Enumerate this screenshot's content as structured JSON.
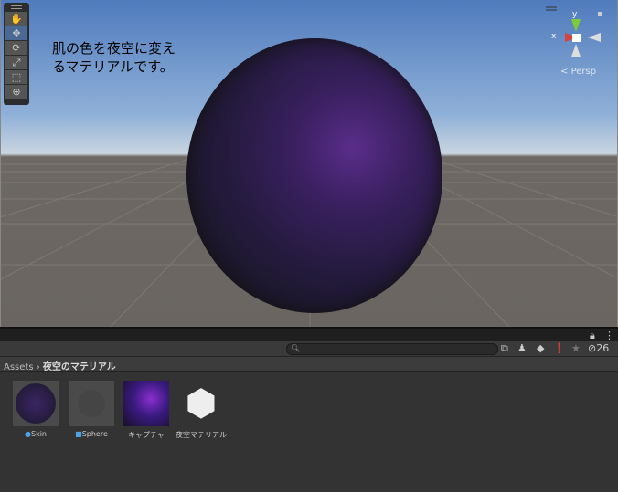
{
  "scene": {
    "caption_line1": "肌の色を夜空に変え",
    "caption_line2": "るマテリアルです。",
    "projection": "Persp",
    "gizmo_x": "x",
    "gizmo_y": "y",
    "tools": [
      "hand-tool",
      "move-tool",
      "rotate-tool",
      "scale-tool",
      "rect-tool",
      "transform-tool"
    ]
  },
  "project": {
    "search_placeholder": "",
    "hidden_count": "26",
    "breadcrumb": {
      "root": "Assets",
      "folder": "夜空のマテリアル"
    },
    "assets": [
      {
        "name": "Skin",
        "type": "material"
      },
      {
        "name": "Sphere",
        "type": "mesh"
      },
      {
        "name": "キャプチャ",
        "type": "texture"
      },
      {
        "name": "夜空マテリアル",
        "type": "unity-scene"
      }
    ]
  },
  "colors": {
    "accent": "#4a6a95"
  }
}
